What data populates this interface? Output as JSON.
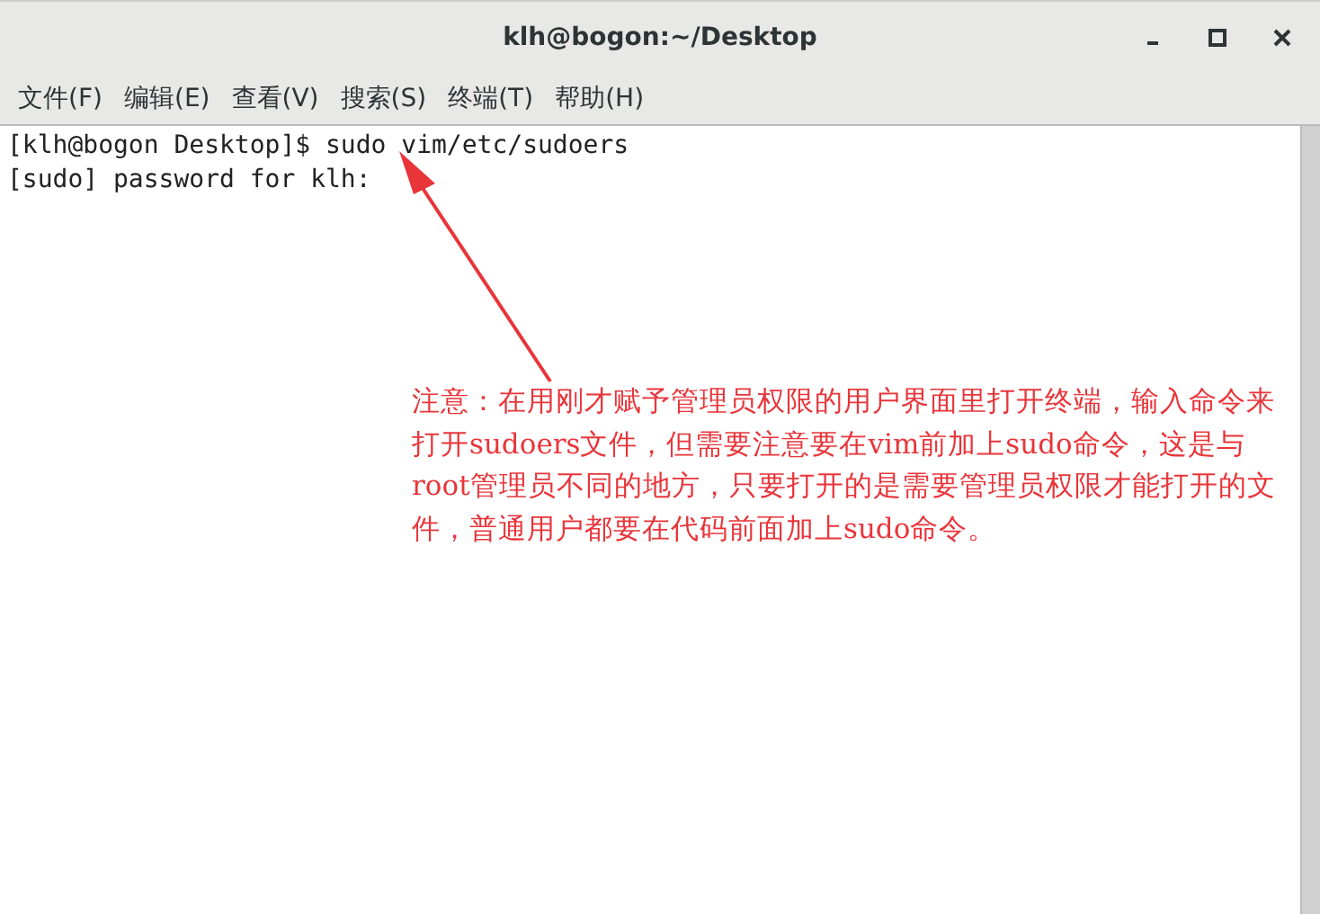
{
  "window": {
    "title": "klh@bogon:~/Desktop",
    "controls": [
      {
        "kind": "minimize"
      },
      {
        "kind": "maximize"
      },
      {
        "kind": "close"
      }
    ]
  },
  "menu": [
    "文件(F)",
    "编辑(E)",
    "查看(V)",
    "搜索(S)",
    "终端(T)",
    "帮助(H)"
  ],
  "terminal": {
    "lines": [
      "[klh@bogon Desktop]$ sudo vim/etc/sudoers",
      "[sudo] password for klh:"
    ]
  },
  "annotation": {
    "text": "注意：在用刚才赋予管理员权限的用户界面里打开终端，输入命令来打开sudoers文件，但需要注意要在vim前加上sudo命令，这是与root管理员不同的地方，只要打开的是需要管理员权限才能打开的文件，普通用户都要在代码前面加上sudo命令。"
  }
}
